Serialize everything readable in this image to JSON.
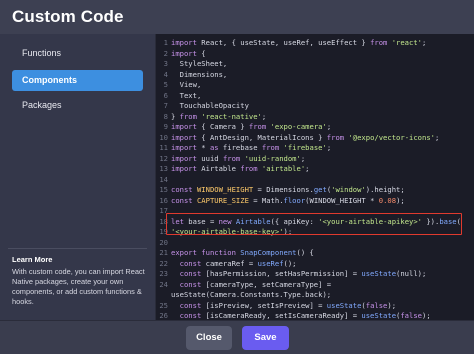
{
  "modal": {
    "title": "Custom Code"
  },
  "sidebar": {
    "items": [
      {
        "label": "Functions",
        "active": false
      },
      {
        "label": "Components",
        "active": true
      },
      {
        "label": "Packages",
        "active": false
      }
    ],
    "learn_more": {
      "title": "Learn More",
      "text": "With custom code, you can import React Native packages, create your own components, or add custom functions & hooks."
    }
  },
  "editor": {
    "highlight_color": "#e03a2e",
    "lines": [
      {
        "n": "1",
        "parts": [
          [
            "k",
            "import"
          ],
          [
            "p",
            " React, { useState, useRef, useEffect } "
          ],
          [
            "k",
            "from"
          ],
          [
            "p",
            " "
          ],
          [
            "s",
            "'react'"
          ],
          [
            "p",
            ";"
          ]
        ]
      },
      {
        "n": "2",
        "parts": [
          [
            "k",
            "import"
          ],
          [
            "p",
            " {"
          ]
        ]
      },
      {
        "n": "3",
        "parts": [
          [
            "p",
            "  StyleSheet,"
          ]
        ]
      },
      {
        "n": "4",
        "parts": [
          [
            "p",
            "  Dimensions,"
          ]
        ]
      },
      {
        "n": "5",
        "parts": [
          [
            "p",
            "  View,"
          ]
        ]
      },
      {
        "n": "6",
        "parts": [
          [
            "p",
            "  Text,"
          ]
        ]
      },
      {
        "n": "7",
        "parts": [
          [
            "p",
            "  TouchableOpacity"
          ]
        ]
      },
      {
        "n": "8",
        "parts": [
          [
            "p",
            "} "
          ],
          [
            "k",
            "from"
          ],
          [
            "p",
            " "
          ],
          [
            "s",
            "'react-native'"
          ],
          [
            "p",
            ";"
          ]
        ]
      },
      {
        "n": "9",
        "parts": [
          [
            "k",
            "import"
          ],
          [
            "p",
            " { Camera } "
          ],
          [
            "k",
            "from"
          ],
          [
            "p",
            " "
          ],
          [
            "s",
            "'expo-camera'"
          ],
          [
            "p",
            ";"
          ]
        ]
      },
      {
        "n": "10",
        "parts": [
          [
            "k",
            "import"
          ],
          [
            "p",
            " { AntDesign, MaterialIcons } "
          ],
          [
            "k",
            "from"
          ],
          [
            "p",
            " "
          ],
          [
            "s",
            "'@expo/vector-icons'"
          ],
          [
            "p",
            ";"
          ]
        ]
      },
      {
        "n": "11",
        "parts": [
          [
            "k",
            "import"
          ],
          [
            "p",
            " * "
          ],
          [
            "k",
            "as"
          ],
          [
            "p",
            " firebase "
          ],
          [
            "k",
            "from"
          ],
          [
            "p",
            " "
          ],
          [
            "s",
            "'firebase'"
          ],
          [
            "p",
            ";"
          ]
        ]
      },
      {
        "n": "12",
        "parts": [
          [
            "k",
            "import"
          ],
          [
            "p",
            " uuid "
          ],
          [
            "k",
            "from"
          ],
          [
            "p",
            " "
          ],
          [
            "s",
            "'uuid-random'"
          ],
          [
            "p",
            ";"
          ]
        ]
      },
      {
        "n": "13",
        "parts": [
          [
            "k",
            "import"
          ],
          [
            "p",
            " Airtable "
          ],
          [
            "k",
            "from"
          ],
          [
            "p",
            " "
          ],
          [
            "s",
            "'airtable'"
          ],
          [
            "p",
            ";"
          ]
        ]
      },
      {
        "n": "14",
        "parts": []
      },
      {
        "n": "15",
        "parts": [
          [
            "k",
            "const"
          ],
          [
            "p",
            " "
          ],
          [
            "c",
            "WINDOW_HEIGHT"
          ],
          [
            "p",
            " = Dimensions."
          ],
          [
            "f",
            "get"
          ],
          [
            "p",
            "("
          ],
          [
            "s",
            "'window'"
          ],
          [
            "p",
            ").height;"
          ]
        ]
      },
      {
        "n": "16",
        "parts": [
          [
            "k",
            "const"
          ],
          [
            "p",
            " "
          ],
          [
            "c",
            "CAPTURE_SIZE"
          ],
          [
            "p",
            " = Math."
          ],
          [
            "f",
            "floor"
          ],
          [
            "p",
            "(WINDOW_HEIGHT * "
          ],
          [
            "n",
            "0.08"
          ],
          [
            "p",
            ");"
          ]
        ]
      },
      {
        "n": "17",
        "parts": []
      },
      {
        "n": "18",
        "parts": [
          [
            "k",
            "let"
          ],
          [
            "p",
            " base = "
          ],
          [
            "k",
            "new"
          ],
          [
            "p",
            " "
          ],
          [
            "f",
            "Airtable"
          ],
          [
            "p",
            "({ apiKey: "
          ],
          [
            "s",
            "'<your-airtable-apikey>'"
          ],
          [
            "p",
            " })."
          ],
          [
            "f",
            "base"
          ],
          [
            "p",
            "("
          ]
        ]
      },
      {
        "n": "19",
        "parts": [
          [
            "s",
            "'<your-airtable-base-key>'"
          ],
          [
            "p",
            ");"
          ]
        ]
      },
      {
        "n": "20",
        "parts": []
      },
      {
        "n": "21",
        "parts": [
          [
            "k",
            "export function"
          ],
          [
            "p",
            " "
          ],
          [
            "f",
            "SnapComponent"
          ],
          [
            "p",
            "() {"
          ]
        ]
      },
      {
        "n": "22",
        "parts": [
          [
            "p",
            "  "
          ],
          [
            "k",
            "const"
          ],
          [
            "p",
            " cameraRef = "
          ],
          [
            "f",
            "useRef"
          ],
          [
            "p",
            "();"
          ]
        ]
      },
      {
        "n": "23",
        "parts": [
          [
            "p",
            "  "
          ],
          [
            "k",
            "const"
          ],
          [
            "p",
            " [hasPermission, setHasPermission] = "
          ],
          [
            "f",
            "useState"
          ],
          [
            "p",
            "(null);"
          ]
        ]
      },
      {
        "n": "24",
        "parts": [
          [
            "p",
            "  "
          ],
          [
            "k",
            "const"
          ],
          [
            "p",
            " [cameraType, setCameraType] ="
          ]
        ]
      },
      {
        "n": "",
        "parts": [
          [
            "p",
            "useState(Camera.Constants.Type.back);"
          ]
        ]
      },
      {
        "n": "25",
        "parts": [
          [
            "p",
            "  "
          ],
          [
            "k",
            "const"
          ],
          [
            "p",
            " [isPreview, setIsPreview] = "
          ],
          [
            "f",
            "useState"
          ],
          [
            "p",
            "("
          ],
          [
            "k",
            "false"
          ],
          [
            "p",
            ");"
          ]
        ]
      },
      {
        "n": "26",
        "parts": [
          [
            "p",
            "  "
          ],
          [
            "k",
            "const"
          ],
          [
            "p",
            " [isCameraReady, setIsCameraReady] = "
          ],
          [
            "f",
            "useState"
          ],
          [
            "p",
            "("
          ],
          [
            "k",
            "false"
          ],
          [
            "p",
            ");"
          ]
        ]
      }
    ]
  },
  "footer": {
    "close_label": "Close",
    "save_label": "Save"
  }
}
